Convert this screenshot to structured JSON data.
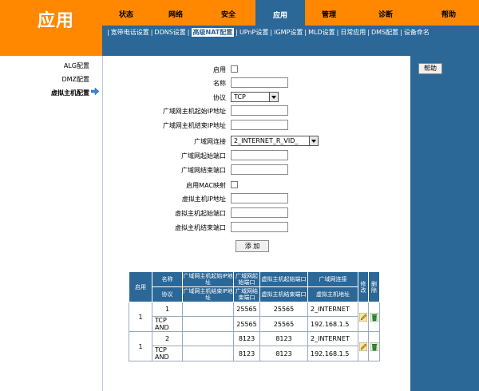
{
  "app": {
    "title": "应用"
  },
  "main_tabs": [
    "状态",
    "网络",
    "安全",
    "应用",
    "管理",
    "诊断",
    "帮助"
  ],
  "sub_nav": [
    "宽带电话设置",
    "DDNS设置",
    "高级NAT配置",
    "UPnP设置",
    "IGMP设置",
    "MLD设置",
    "日常应用",
    "DMS配置",
    "设备命名"
  ],
  "left_nav": [
    "ALG配置",
    "DMZ配置",
    "虚拟主机配置"
  ],
  "help_label": "帮助",
  "form": {
    "enable_label": "启用",
    "name_label": "名称",
    "protocol_label": "协议",
    "protocol_value": "TCP",
    "wan_start_ip_label": "广域网主机起始IP地址",
    "wan_end_ip_label": "广域网主机结束IP地址",
    "wan_conn_label": "广域网连接",
    "wan_conn_value": "2_INTERNET_R_VID_",
    "wan_start_port_label": "广域网起始端口",
    "wan_end_port_label": "广域网结束端口",
    "mac_label": "启用MAC映射",
    "vhost_ip_label": "虚拟主机IP地址",
    "vhost_start_port_label": "虚拟主机起始端口",
    "vhost_end_port_label": "虚拟主机结束端口",
    "add_label": "添 加"
  },
  "table": {
    "headers": {
      "enable": "启用",
      "name": "名称",
      "protocol": "协议",
      "wan_start_ip": "广域网主机起始IP地址",
      "wan_end_ip": "广域网主机结束IP地址",
      "wan_start_port": "广域网起始端口",
      "wan_end_port": "广域网结束端口",
      "vhost_start_port": "虚拟主机起始端口",
      "vhost_end_port": "虚拟主机结束端口",
      "wan_conn": "广域网连接",
      "vhost_ip": "虚拟主机地址",
      "edit": "修改",
      "delete": "删除"
    },
    "rows": [
      {
        "enable": "1",
        "name": "1",
        "protocol": "TCP AND",
        "wan_start_ip": "",
        "wan_end_ip": "",
        "wan_start_port": "25565",
        "wan_end_port": "25565",
        "vhost_start_port": "25565",
        "vhost_end_port": "25565",
        "wan_conn": "2_INTERNET",
        "vhost_ip": "192.168.1.5"
      },
      {
        "enable": "1",
        "name": "2",
        "protocol": "TCP AND",
        "wan_start_ip": "",
        "wan_end_ip": "",
        "wan_start_port": "8123",
        "wan_end_port": "8123",
        "vhost_start_port": "8123",
        "vhost_end_port": "8123",
        "wan_conn": "2_INTERNET",
        "vhost_ip": "192.168.1.5"
      }
    ]
  },
  "colors": {
    "orange": "#ff8800",
    "blue": "#2b6797",
    "white": "#ffffff"
  },
  "icons": {
    "edit": "pencil-icon",
    "delete": "trash-icon",
    "nav_arrow": "arrow-right-icon"
  }
}
